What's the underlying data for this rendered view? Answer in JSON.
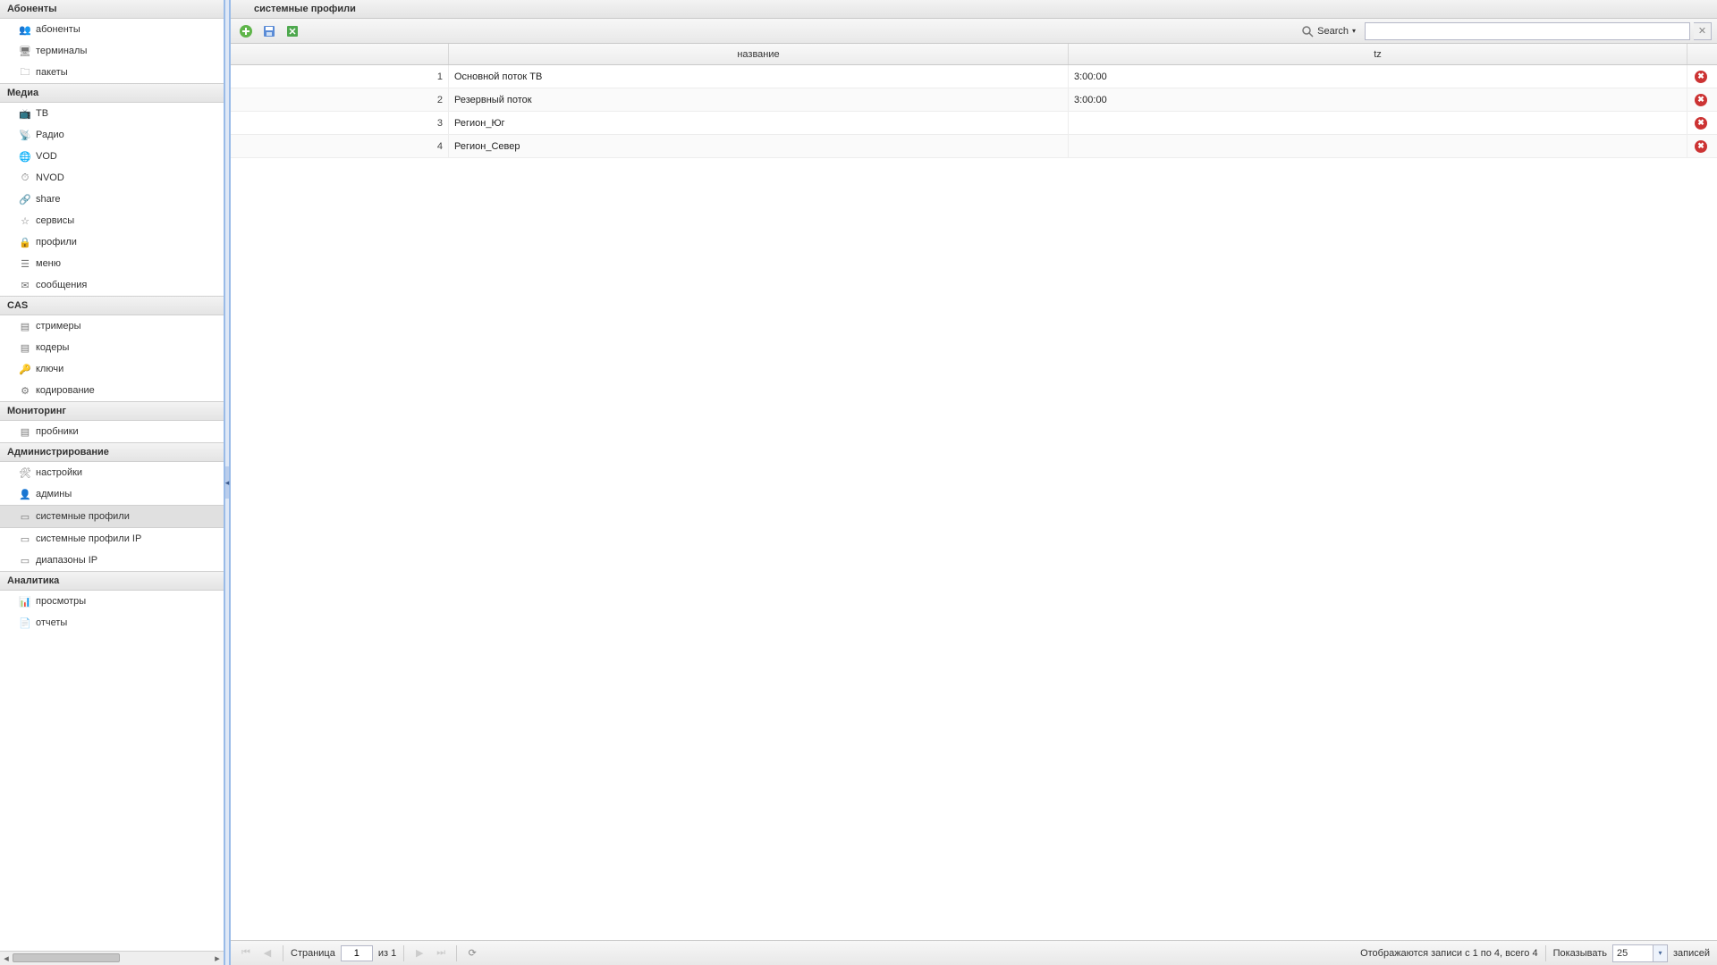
{
  "sidebar": {
    "groups": [
      {
        "title": "Абоненты",
        "items": [
          {
            "label": "абоненты",
            "icon": "users"
          },
          {
            "label": "терминалы",
            "icon": "terminal"
          },
          {
            "label": "пакеты",
            "icon": "folder"
          }
        ]
      },
      {
        "title": "Медиа",
        "items": [
          {
            "label": "ТВ",
            "icon": "tv"
          },
          {
            "label": "Радио",
            "icon": "radio"
          },
          {
            "label": "VOD",
            "icon": "vod"
          },
          {
            "label": "NVOD",
            "icon": "nvod"
          },
          {
            "label": "share",
            "icon": "share"
          },
          {
            "label": "сервисы",
            "icon": "star"
          },
          {
            "label": "профили",
            "icon": "lock"
          },
          {
            "label": "меню",
            "icon": "menu"
          },
          {
            "label": "сообщения",
            "icon": "message"
          }
        ]
      },
      {
        "title": "CAS",
        "items": [
          {
            "label": "стримеры",
            "icon": "server"
          },
          {
            "label": "кодеры",
            "icon": "server"
          },
          {
            "label": "ключи",
            "icon": "key"
          },
          {
            "label": "кодирование",
            "icon": "encoding"
          }
        ]
      },
      {
        "title": "Мониторинг",
        "items": [
          {
            "label": "пробники",
            "icon": "probe"
          }
        ]
      },
      {
        "title": "Администрирование",
        "items": [
          {
            "label": "настройки",
            "icon": "settings"
          },
          {
            "label": "админы",
            "icon": "admins"
          },
          {
            "label": "системные профили",
            "icon": "card",
            "active": true
          },
          {
            "label": "системные профили IP",
            "icon": "card"
          },
          {
            "label": "диапазоны IP",
            "icon": "card"
          }
        ]
      },
      {
        "title": "Аналитика",
        "items": [
          {
            "label": "просмотры",
            "icon": "views"
          },
          {
            "label": "отчеты",
            "icon": "reports"
          }
        ]
      }
    ]
  },
  "panel": {
    "title": "системные профили"
  },
  "toolbar": {
    "search_label": "Search"
  },
  "columns": {
    "name": "название",
    "tz": "tz"
  },
  "rows": [
    {
      "num": "1",
      "name": "Основной поток ТВ",
      "tz": "3:00:00"
    },
    {
      "num": "2",
      "name": "Резервный поток",
      "tz": "3:00:00"
    },
    {
      "num": "3",
      "name": "Регион_Юг",
      "tz": ""
    },
    {
      "num": "4",
      "name": "Регион_Север",
      "tz": ""
    }
  ],
  "pager": {
    "page_label": "Страница",
    "page_value": "1",
    "of_label": "из 1",
    "status": "Отображаются записи с 1 по 4, всего 4",
    "show_label": "Показывать",
    "page_size": "25",
    "records_label": "записей"
  }
}
